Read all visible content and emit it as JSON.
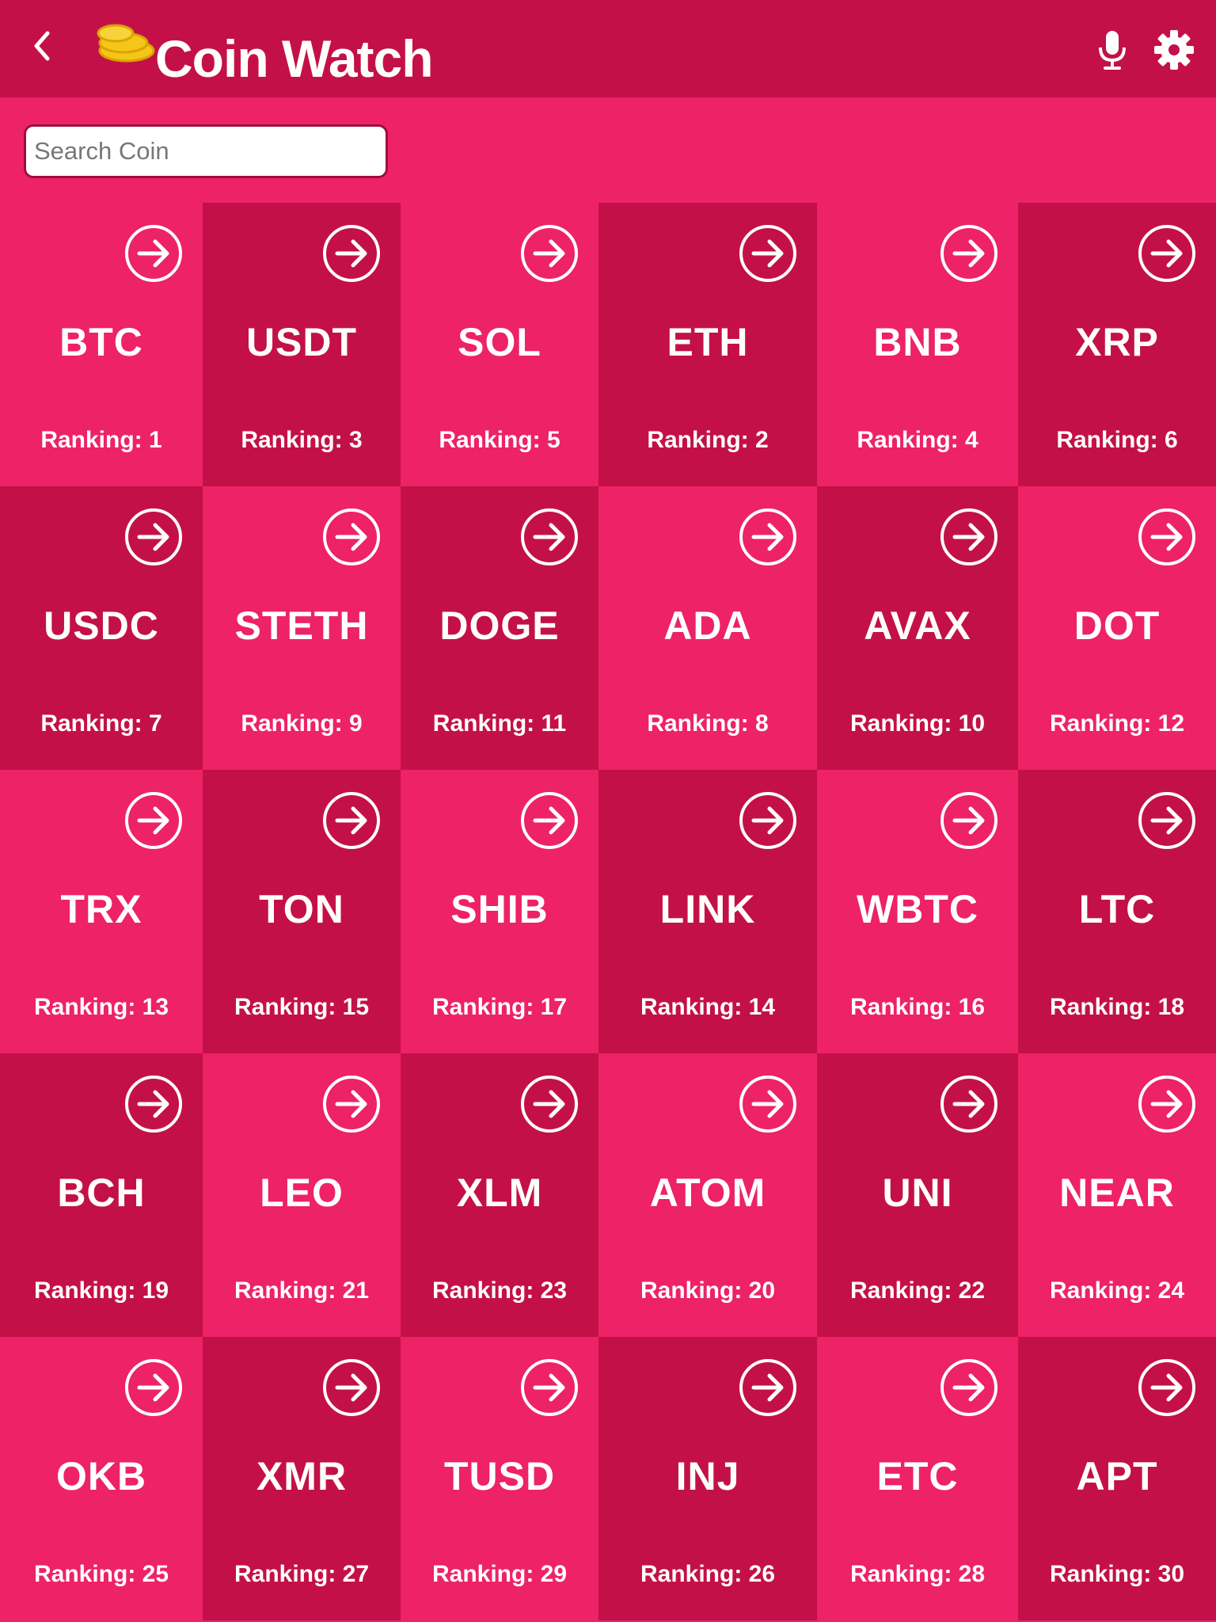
{
  "header": {
    "title": "Coin Watch",
    "back_icon": "chevron-left-icon",
    "logo_icon": "coins-icon",
    "mic_icon": "microphone-icon",
    "settings_icon": "gear-icon"
  },
  "search": {
    "placeholder": "Search Coin",
    "value": ""
  },
  "colors": {
    "header": "#c41048",
    "tile_dark": "#c41048",
    "tile_light": "#ee2266",
    "logo": "#f5c518"
  },
  "coins": [
    {
      "symbol": "BTC",
      "rank": "Ranking: 1"
    },
    {
      "symbol": "USDT",
      "rank": "Ranking: 3"
    },
    {
      "symbol": "SOL",
      "rank": "Ranking: 5"
    },
    {
      "symbol": "ETH",
      "rank": "Ranking: 2"
    },
    {
      "symbol": "BNB",
      "rank": "Ranking: 4"
    },
    {
      "symbol": "XRP",
      "rank": "Ranking: 6"
    },
    {
      "symbol": "USDC",
      "rank": "Ranking: 7"
    },
    {
      "symbol": "STETH",
      "rank": "Ranking: 9"
    },
    {
      "symbol": "DOGE",
      "rank": "Ranking: 11"
    },
    {
      "symbol": "ADA",
      "rank": "Ranking: 8"
    },
    {
      "symbol": "AVAX",
      "rank": "Ranking: 10"
    },
    {
      "symbol": "DOT",
      "rank": "Ranking: 12"
    },
    {
      "symbol": "TRX",
      "rank": "Ranking: 13"
    },
    {
      "symbol": "TON",
      "rank": "Ranking: 15"
    },
    {
      "symbol": "SHIB",
      "rank": "Ranking: 17"
    },
    {
      "symbol": "LINK",
      "rank": "Ranking: 14"
    },
    {
      "symbol": "WBTC",
      "rank": "Ranking: 16"
    },
    {
      "symbol": "LTC",
      "rank": "Ranking: 18"
    },
    {
      "symbol": "BCH",
      "rank": "Ranking: 19"
    },
    {
      "symbol": "LEO",
      "rank": "Ranking: 21"
    },
    {
      "symbol": "XLM",
      "rank": "Ranking: 23"
    },
    {
      "symbol": "ATOM",
      "rank": "Ranking: 20"
    },
    {
      "symbol": "UNI",
      "rank": "Ranking: 22"
    },
    {
      "symbol": "NEAR",
      "rank": "Ranking: 24"
    },
    {
      "symbol": "OKB",
      "rank": "Ranking: 25"
    },
    {
      "symbol": "XMR",
      "rank": "Ranking: 27"
    },
    {
      "symbol": "TUSD",
      "rank": "Ranking: 29"
    },
    {
      "symbol": "INJ",
      "rank": "Ranking: 26"
    },
    {
      "symbol": "ETC",
      "rank": "Ranking: 28"
    },
    {
      "symbol": "APT",
      "rank": "Ranking: 30"
    }
  ],
  "tile_icon": "arrow-right-circle-icon"
}
